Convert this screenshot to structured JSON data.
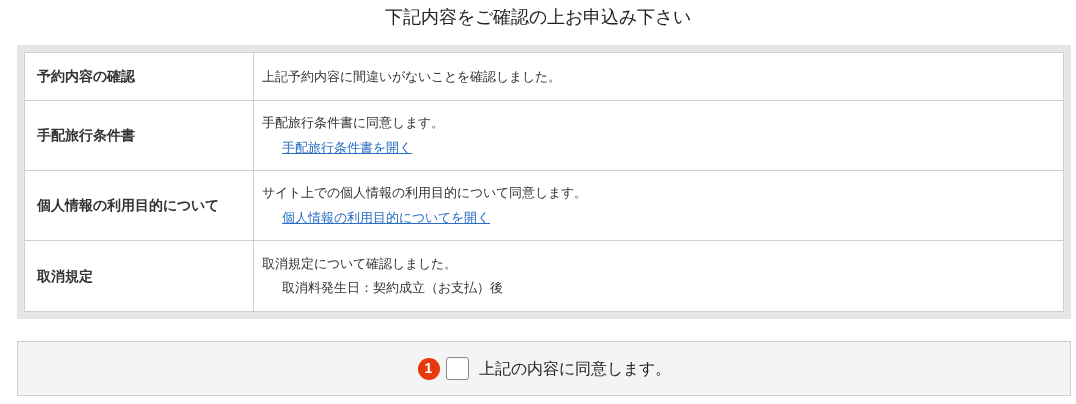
{
  "heading": "下記内容をご確認の上お申込み下さい",
  "rows": [
    {
      "label": "予約内容の確認",
      "lines": [
        {
          "kind": "text",
          "text": "上記予約内容に間違いがないことを確認しました。"
        }
      ]
    },
    {
      "label": "手配旅行条件書",
      "lines": [
        {
          "kind": "text",
          "text": "手配旅行条件書に同意します。"
        },
        {
          "kind": "link",
          "text": "手配旅行条件書を開く"
        }
      ]
    },
    {
      "label": "個人情報の利用目的について",
      "lines": [
        {
          "kind": "text",
          "text": "サイト上での個人情報の利用目的について同意します。"
        },
        {
          "kind": "link",
          "text": "個人情報の利用目的についてを開く"
        }
      ]
    },
    {
      "label": "取消規定",
      "lines": [
        {
          "kind": "text",
          "text": "取消規定について確認しました。"
        },
        {
          "kind": "note",
          "text": "取消料発生日：契約成立（お支払）後"
        }
      ]
    }
  ],
  "agreement": {
    "step": "1",
    "label": "上記の内容に同意します。",
    "checked": false
  }
}
